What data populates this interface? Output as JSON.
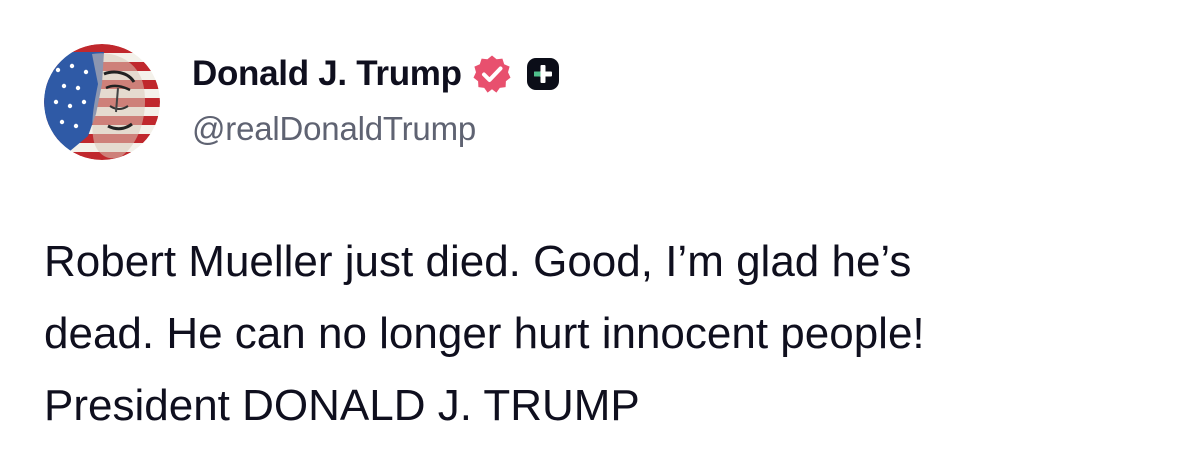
{
  "author": {
    "display_name": "Donald J. Trump",
    "handle": "@realDonaldTrump",
    "avatar_icon": "flag-portrait-avatar",
    "verified_icon": "verified-badge-icon",
    "verified_color": "#e8506e",
    "subscriber_icon": "plus-badge-icon"
  },
  "post": {
    "lines": [
      "Robert Mueller just died. Good, I’m glad he’s",
      "dead. He can no longer hurt innocent people!",
      "President DONALD J. TRUMP"
    ]
  }
}
